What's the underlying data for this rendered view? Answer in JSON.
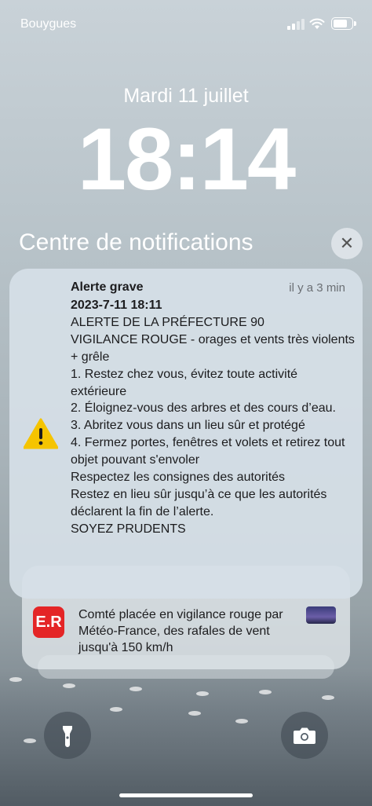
{
  "status": {
    "carrier": "Bouygues",
    "battery_level": 0.8,
    "icons": [
      "cellular-signal-icon",
      "wifi-icon",
      "battery-icon"
    ]
  },
  "lockscreen": {
    "date": "Mardi 11 juillet",
    "time": "18:14"
  },
  "notification_center": {
    "title": "Centre de notifications",
    "close_icon": "✕"
  },
  "alert": {
    "title": "Alerte grave",
    "age": "il y a 3 min",
    "icon": "warning-icon",
    "lines": [
      "2023-7-11 18:11",
      "ALERTE DE LA PRÉFECTURE 90",
      "VIGILANCE ROUGE - orages et vents très violents + grêle",
      "1. Restez chez vous, évitez toute activité extérieure",
      "2. Éloignez-vous des arbres et des cours d’eau.",
      "3. Abritez vous dans un lieu sûr et protégé",
      "4. Fermez portes, fenêtres et volets et retirez tout objet pouvant s'envoler",
      "Respectez les consignes des autorités",
      "Restez en lieu sûr jusqu’à ce que les autorités déclarent la fin de l’alerte.",
      "SOYEZ PRUDENTS"
    ]
  },
  "notification2": {
    "logo_text": "E.R",
    "text": "Comté placée en vigilance rouge par Météo-France, des rafales de vent jusqu'à 150 km/h",
    "colors": {
      "logo": "#e42526"
    }
  },
  "quick_actions": {
    "left": "flashlight-icon",
    "right": "camera-icon"
  }
}
